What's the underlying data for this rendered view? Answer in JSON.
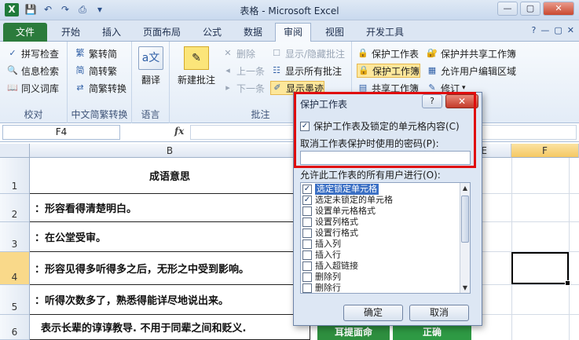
{
  "window": {
    "title": "表格 - Microsoft Excel",
    "logo": "X",
    "min": "—",
    "restore": "▢",
    "close": "✕"
  },
  "tabs": [
    {
      "label": "文件",
      "id": "file"
    },
    {
      "label": "开始",
      "id": "home"
    },
    {
      "label": "插入",
      "id": "insert"
    },
    {
      "label": "页面布局",
      "id": "page-layout"
    },
    {
      "label": "公式",
      "id": "formulas"
    },
    {
      "label": "数据",
      "id": "data"
    },
    {
      "label": "审阅",
      "id": "review"
    },
    {
      "label": "视图",
      "id": "view"
    },
    {
      "label": "开发工具",
      "id": "developer"
    }
  ],
  "ribbon": {
    "proofing": {
      "label": "校对",
      "spell": "拼写检查",
      "research": "信息检索",
      "thesaurus": "同义词库"
    },
    "chinese": {
      "label": "中文简繁转换",
      "to_trad": "繁转简",
      "to_simp": "简转繁",
      "convert": "简繁转换"
    },
    "language": {
      "label": "语言",
      "translate": "翻译"
    },
    "comments": {
      "label": "批注",
      "new": "新建批注",
      "delete": "删除",
      "prev": "上一条",
      "next": "下一条",
      "show_hide": "显示/隐藏批注",
      "show_all": "显示所有批注",
      "show_ink": "显示墨迹"
    },
    "changes": {
      "protect_sheet": "保护工作表",
      "protect_book": "保护工作簿",
      "share_book": "共享工作簿",
      "protect_share": "保护并共享工作簿",
      "allow_edit": "允许用户编辑区域",
      "track": "修订"
    }
  },
  "formula_bar": {
    "name_box": "F4",
    "fx": "fx",
    "value": ""
  },
  "columns": [
    "B",
    "E",
    "F"
  ],
  "rows": [
    "1",
    "2",
    "3",
    "4",
    "5",
    "6"
  ],
  "cells": {
    "b1": "成语意思",
    "b2": "：形容看得清楚明白。",
    "b3": "：在公堂受审。",
    "b4": "：形容见得多听得多之后，无形之中受到影响。",
    "b5": "：听得次数多了，熟悉得能详尽地说出来。",
    "b6": "表示长辈的谆谆教导. 不用于同辈之间和贬义.",
    "d6": "耳提面命",
    "e6": "正确"
  },
  "dialog": {
    "title": "保护工作表",
    "help": "?",
    "close": "✕",
    "protect_label": "保护工作表及锁定的单元格内容(C)",
    "protect_checked": true,
    "password_label": "取消工作表保护时使用的密码(P):",
    "password_value": "",
    "allow_label": "允许此工作表的所有用户进行(O):",
    "permissions": [
      {
        "label": "选定锁定单元格",
        "checked": true
      },
      {
        "label": "选定未锁定的单元格",
        "checked": true
      },
      {
        "label": "设置单元格格式",
        "checked": false
      },
      {
        "label": "设置列格式",
        "checked": false
      },
      {
        "label": "设置行格式",
        "checked": false
      },
      {
        "label": "插入列",
        "checked": false
      },
      {
        "label": "插入行",
        "checked": false
      },
      {
        "label": "插入超链接",
        "checked": false
      },
      {
        "label": "删除列",
        "checked": false
      },
      {
        "label": "删除行",
        "checked": false
      }
    ],
    "ok": "确定",
    "cancel": "取消"
  },
  "colors": {
    "file_tab": "#2b7b3c",
    "highlight_box": "#e00d0d",
    "selection": "#3a6fc4",
    "green_cell": "#2e9a44"
  }
}
